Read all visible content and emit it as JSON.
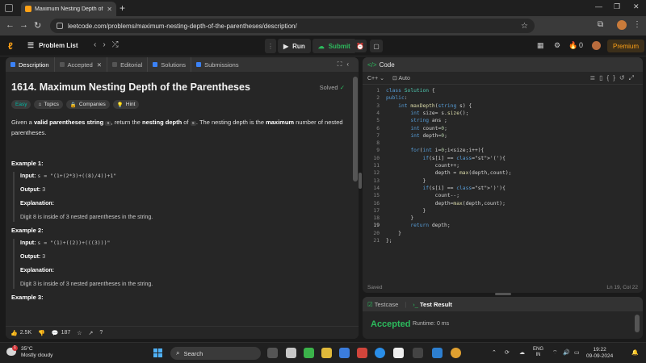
{
  "browser": {
    "tab_title": "Maximum Nesting Depth of the",
    "url": "leetcode.com/problems/maximum-nesting-depth-of-the-parentheses/description/"
  },
  "nav": {
    "problem_list": "Problem List",
    "run": "Run",
    "submit": "Submit",
    "coins": "0",
    "premium": "Premium"
  },
  "left_tabs": [
    "Description",
    "Accepted",
    "Editorial",
    "Solutions",
    "Submissions"
  ],
  "problem": {
    "title": "1614. Maximum Nesting Depth of the Parentheses",
    "solved": "Solved",
    "tags": [
      "Easy",
      "Topics",
      "Companies",
      "Hint"
    ],
    "desc_1": "Given a ",
    "desc_b1": "valid parentheses string",
    "desc_code": "s",
    "desc_2": ", return the ",
    "desc_b2": "nesting depth",
    "desc_3": " of ",
    "desc_4": ". The nesting depth is the ",
    "desc_b3": "maximum",
    "desc_5": " number of nested parentheses."
  },
  "examples": [
    {
      "heading": "Example 1:",
      "input_label": "Input:",
      "input": "s = \"(1+(2*3)+((8)/4))+1\"",
      "output_label": "Output:",
      "output": "3",
      "explanation_label": "Explanation:",
      "explanation": "Digit 8 is inside of 3 nested parentheses in the string."
    },
    {
      "heading": "Example 2:",
      "input_label": "Input:",
      "input": "s = \"(1)+((2))+(((3)))\"",
      "output_label": "Output:",
      "output": "3",
      "explanation_label": "Explanation:",
      "explanation": "Digit 3 is inside of 3 nested parentheses in the string."
    },
    {
      "heading": "Example 3:"
    }
  ],
  "footer": {
    "likes": "2.5K",
    "comments": "187"
  },
  "editor": {
    "header": "Code",
    "language": "C++",
    "auto": "Auto",
    "status_saved": "Saved",
    "cursor": "Ln 19, Col 22",
    "lines": [
      "class Solution {",
      "public:",
      "    int maxDepth(string s) {",
      "        int size= s.size();",
      "        string ans ;",
      "        int count=0;",
      "        int depth=0;",
      "",
      "        for(int i=0;i<size;i++){",
      "            if(s[i] == '('){",
      "                count++;",
      "                depth = max(depth,count);",
      "            }",
      "            if(s[i] == ')'){",
      "                count--;",
      "                depth=max(depth,count);",
      "            }",
      "        }",
      "        return depth;",
      "    }",
      "};"
    ]
  },
  "result": {
    "tab_testcase": "Testcase",
    "tab_result": "Test Result",
    "status": "Accepted",
    "runtime": "Runtime: 0 ms"
  },
  "taskbar": {
    "temp": "35°C",
    "weather": "Mostly cloudy",
    "search": "Search",
    "lang_1": "ENG",
    "lang_2": "IN",
    "time": "19:22",
    "date": "09-09-2024",
    "badge": "1"
  }
}
